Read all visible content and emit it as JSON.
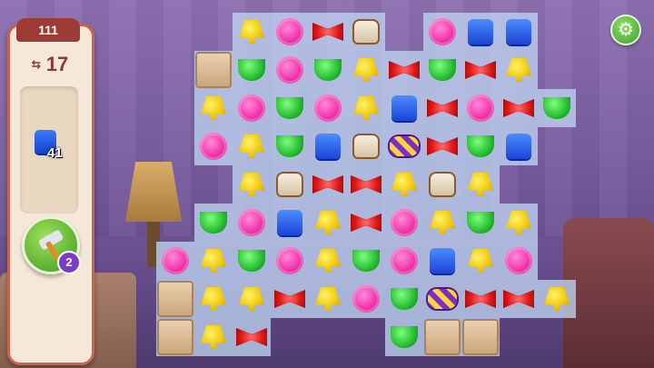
{
  "level": {
    "number": "111"
  },
  "moves": {
    "icon": "moves-icon",
    "value": "17"
  },
  "goal": {
    "icon": "blue-cube-icon",
    "count": "41"
  },
  "booster": {
    "icon": "hammer-icon",
    "count": "2"
  },
  "settings": {
    "icon": "gear-icon"
  },
  "colors": {
    "panel_border": "#c9644f",
    "header": "#9d3b37",
    "board_cell": "#bed4f0"
  },
  "board": {
    "rows": [
      [
        "Y",
        "P",
        "R",
        "Pu",
        null,
        "P",
        "B",
        "B",
        null,
        null,
        null
      ],
      [
        "X",
        "G",
        "P",
        "G",
        "Y",
        "R",
        "G",
        "R",
        "Y",
        null,
        null
      ],
      [
        "Y",
        "P",
        "G",
        "P",
        "Y",
        "B",
        "R",
        "P",
        "R",
        "G",
        null
      ],
      [
        "P",
        "Y",
        "G",
        "B",
        "Pu",
        "C",
        "R",
        "G",
        "B",
        null,
        null
      ],
      [
        "Y",
        "Pu",
        "R",
        "R",
        "Y",
        "Pu",
        "Y",
        null,
        null,
        null,
        null
      ],
      [
        "G",
        "P",
        "B",
        "Y",
        "R",
        "P",
        "Y",
        "G",
        "Y",
        null,
        null
      ],
      [
        "P",
        "Y",
        "G",
        "P",
        "Y",
        "G",
        "P",
        "B",
        "Y",
        "P",
        null
      ],
      [
        "X",
        "Y",
        "Y",
        "R",
        "Y",
        "P",
        "G",
        "C",
        "R",
        "R",
        "Y"
      ],
      [
        "X",
        "Y",
        "R",
        null,
        null,
        null,
        "G",
        "X",
        "X",
        null,
        null
      ]
    ]
  }
}
